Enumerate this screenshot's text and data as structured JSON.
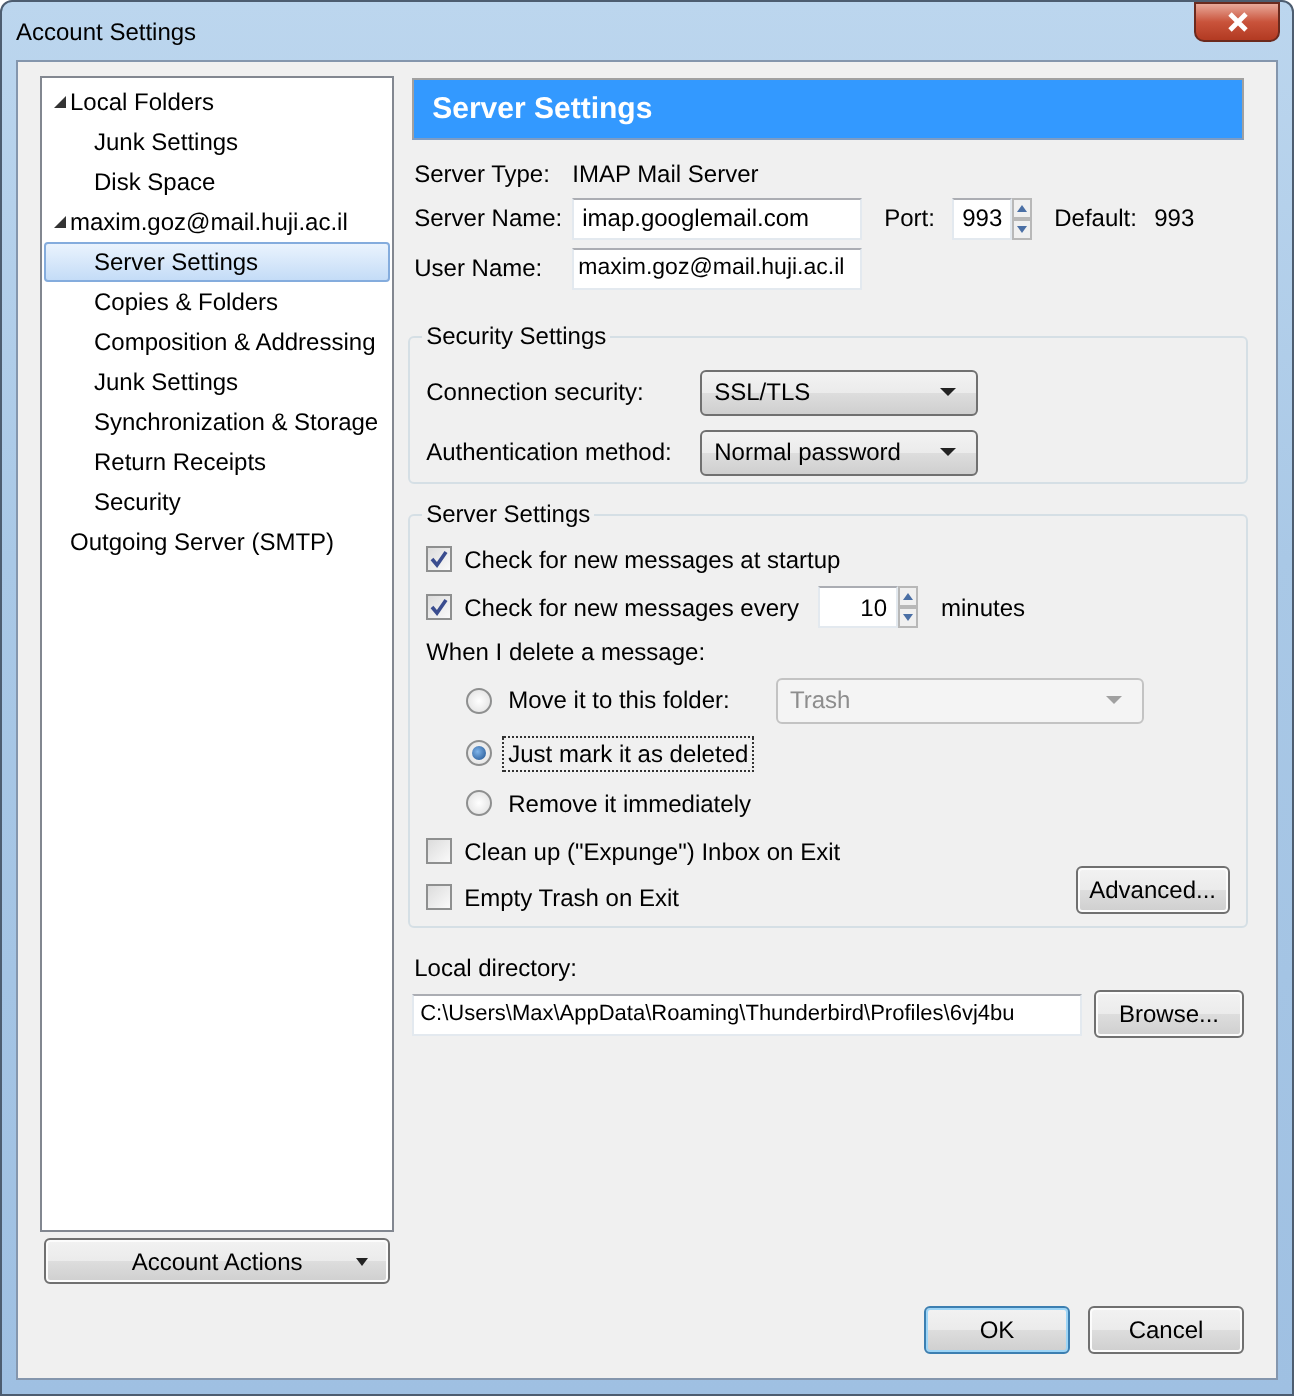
{
  "window": {
    "title": "Account Settings"
  },
  "sidebar": {
    "tree": [
      {
        "label": "Local Folders",
        "expanded": true,
        "selected": false,
        "children": [
          {
            "label": "Junk Settings",
            "selected": false
          },
          {
            "label": "Disk Space",
            "selected": false
          }
        ]
      },
      {
        "label": "maxim.goz@mail.huji.ac.il",
        "expanded": true,
        "selected": false,
        "children": [
          {
            "label": "Server Settings",
            "selected": true
          },
          {
            "label": "Copies & Folders",
            "selected": false
          },
          {
            "label": "Composition & Addressing",
            "selected": false
          },
          {
            "label": "Junk Settings",
            "selected": false
          },
          {
            "label": "Synchronization & Storage",
            "selected": false
          },
          {
            "label": "Return Receipts",
            "selected": false
          },
          {
            "label": "Security",
            "selected": false
          }
        ]
      },
      {
        "label": "Outgoing Server (SMTP)",
        "selected": false
      }
    ],
    "account_actions": "Account Actions"
  },
  "panel": {
    "title": "Server Settings",
    "server_type": {
      "label": "Server Type:",
      "value": "IMAP Mail Server"
    },
    "server_name": {
      "label": "Server Name:",
      "value": "imap.googlemail.com"
    },
    "port": {
      "label": "Port:",
      "value": "993"
    },
    "default_port": {
      "label": "Default:",
      "value": "993"
    },
    "user_name": {
      "label": "User Name:",
      "value": "maxim.goz@mail.huji.ac.il"
    },
    "security": {
      "legend": "Security Settings",
      "rows": [
        {
          "label": "Connection security:",
          "value": "SSL/TLS"
        },
        {
          "label": "Authentication method:",
          "value": "Normal password"
        }
      ]
    },
    "server_settings": {
      "legend": "Server Settings",
      "check_startup": {
        "label": "Check for new messages at startup",
        "checked": true
      },
      "check_every": {
        "label": "Check for new messages every",
        "checked": true,
        "value": "10",
        "unit": "minutes"
      },
      "delete_label": "When I delete a message:",
      "delete_options": [
        {
          "label": "Move it to this folder:",
          "selected": false,
          "folder": {
            "value": "Trash",
            "disabled": true
          }
        },
        {
          "label": "Just mark it as deleted",
          "selected": true
        },
        {
          "label": "Remove it immediately",
          "selected": false
        }
      ],
      "expunge": {
        "label": "Clean up (\"Expunge\") Inbox on Exit",
        "checked": false
      },
      "empty_trash": {
        "label": "Empty Trash on Exit",
        "checked": false
      },
      "advanced": "Advanced..."
    },
    "local_directory": {
      "label": "Local directory:",
      "value": "C:\\Users\\Max\\AppData\\Roaming\\Thunderbird\\Profiles\\6vj4bu",
      "browse": "Browse..."
    }
  },
  "buttons": [
    {
      "label": "OK",
      "default": true
    },
    {
      "label": "Cancel",
      "default": false
    }
  ]
}
